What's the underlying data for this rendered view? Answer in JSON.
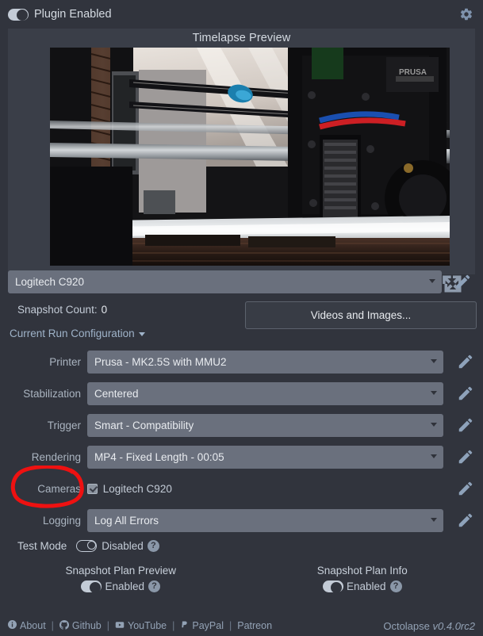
{
  "topbar": {
    "plugin_toggle_label": "Plugin Enabled",
    "plugin_toggle_state": "on",
    "settings_icon": "gear-icon"
  },
  "preview": {
    "title": "Timelapse Preview",
    "expand_icon": "fullscreen-expand-icon",
    "image_description": "Prusa 3D printer carriage webcam still"
  },
  "camera": {
    "selected": "Logitech C920",
    "edit_icon": "pencil-icon"
  },
  "status": {
    "snapshot_count_label": "Snapshot Count:",
    "snapshot_count_value": "0",
    "videos_button": "Videos and Images..."
  },
  "run_config": {
    "heading": "Current Run Configuration",
    "rows": [
      {
        "label": "Printer",
        "value": "Prusa - MK2.5S with MMU2",
        "type": "select"
      },
      {
        "label": "Stabilization",
        "value": "Centered",
        "type": "select"
      },
      {
        "label": "Trigger",
        "value": "Smart - Compatibility",
        "type": "select"
      },
      {
        "label": "Rendering",
        "value": "MP4 - Fixed Length - 00:05",
        "type": "select"
      },
      {
        "label": "Cameras",
        "value": "Logitech C920",
        "type": "checkbox",
        "checked": true
      },
      {
        "label": "Logging",
        "value": "Log All Errors",
        "type": "select"
      }
    ]
  },
  "test_mode": {
    "label": "Test Mode",
    "state_label": "Disabled",
    "state": "off",
    "help": "?"
  },
  "plan_columns": [
    {
      "title": "Snapshot Plan Preview",
      "state_label": "Enabled",
      "state": "on",
      "help": "?"
    },
    {
      "title": "Snapshot Plan Info",
      "state_label": "Enabled",
      "state": "on",
      "help": "?"
    }
  ],
  "footer": {
    "links": [
      {
        "label": "About",
        "icon": "info-circle-icon"
      },
      {
        "label": "Github",
        "icon": "github-icon"
      },
      {
        "label": "YouTube",
        "icon": "youtube-icon"
      },
      {
        "label": "PayPal",
        "icon": "paypal-icon"
      },
      {
        "label": "Patreon",
        "icon": ""
      }
    ],
    "app_name": "Octolapse",
    "version": "v0.4.0rc2"
  },
  "annotation": {
    "type": "red-hand-drawn-circle",
    "target": "Cameras",
    "color": "#ee1111"
  }
}
